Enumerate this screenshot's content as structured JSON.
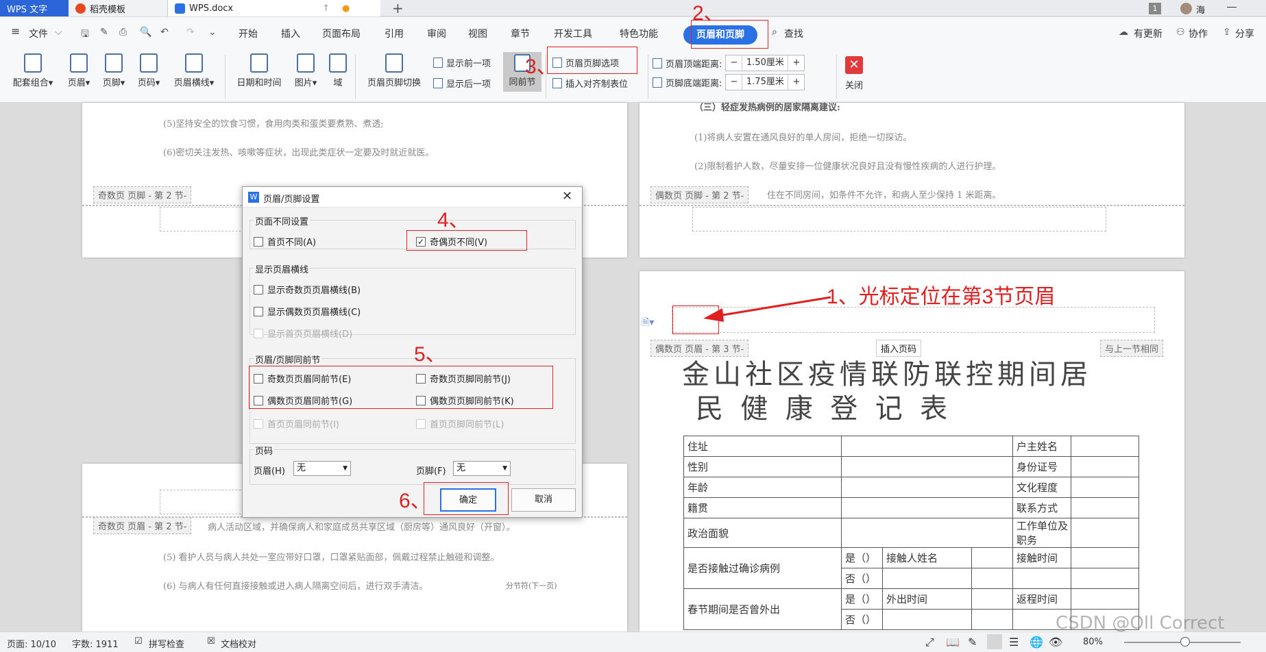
{
  "tabs": {
    "app": "WPS 文字",
    "docer": "稻壳模板",
    "doc": "WPS.docx",
    "user": "海",
    "badge": "1"
  },
  "menu": {
    "items": [
      "文件",
      "开始",
      "插入",
      "页面布局",
      "引用",
      "审阅",
      "视图",
      "章节",
      "开发工具",
      "特色功能",
      "页眉和页脚",
      "查找"
    ],
    "update": "有更新",
    "collab": "协作",
    "share": "分享"
  },
  "ribbon": {
    "combo": "配套组合",
    "header": "页眉",
    "footer": "页脚",
    "pagenum": "页码",
    "hline": "页眉横线",
    "datetime": "日期和时间",
    "picture": "图片",
    "field": "域",
    "switch": "页眉页脚切换",
    "prev": "显示前一项",
    "next": "显示后一项",
    "same": "同前节",
    "options": "页眉页脚选项",
    "align": "插入对齐制表位",
    "top_dist_label": "页眉顶端距离:",
    "top_dist": "1.50厘米",
    "bot_dist_label": "页脚底端距离:",
    "bot_dist": "1.75厘米",
    "close": "关闭"
  },
  "doc": {
    "p1l1": "(5)坚持安全的饮食习惯，食用肉类和蛋类要煮熟、煮透;",
    "p1l2": "(6)密切关注发热、咳嗽等症状，出现此类症状一定要及时就近就医。",
    "odd_footer": "奇数页 页脚 - 第 2 节-",
    "even_footer": "偶数页 页脚 - 第 2 节-",
    "p2l0": "（三）轻症发热病例的居家隔离建议:",
    "p2l1": "(1)将病人安置在通风良好的单人房间，拒绝一切探访。",
    "p2l2": "(2)限制看护人数，尽量安排一位健康状况良好且没有慢性疾病的人进行护理。",
    "p2l3": "住在不同房间，如条件不允许，和病人至少保持 1 米距离。",
    "even_header3": "偶数页 页眉 - 第 3 节-",
    "insert_pagenum": "插入页码",
    "same_as_prev": "与上一节相同",
    "title1": "金山社区疫情联防联控期间居",
    "title2": "民  健  康  登  记  表",
    "odd_header2": "奇数页 页眉 - 第 2 节-",
    "p3l1": "病人活动区域，并确保病人和家庭成员共享区域（厨房等）通风良好（开窗）。",
    "p3l2": "(5) 看护人员与病人共处一室应带好口罩，口罩紧贴面部，佩戴过程禁止触碰和调整。",
    "p3l3": "(6) 与病人有任何直接接触或进入病人隔离空间后，进行双手清洁。",
    "section_break": "分节符(下一页)"
  },
  "table": [
    [
      "住址",
      "",
      "户主姓名",
      ""
    ],
    [
      "性别",
      "",
      "身份证号",
      ""
    ],
    [
      "年龄",
      "",
      "文化程度",
      ""
    ],
    [
      "籍贯",
      "",
      "联系方式",
      ""
    ],
    [
      "政治面貌",
      "",
      "工作单位及职务",
      ""
    ]
  ],
  "table2": {
    "contact": "是否接触过确诊病例",
    "yes": "是（）",
    "no": "否（）",
    "contact_name": "接触人姓名",
    "contact_time": "接触时间",
    "travel": "春节期间是否曾外出",
    "out_time": "外出时间",
    "return_time": "返程时间"
  },
  "dialog": {
    "title": "页眉/页脚设置",
    "g1": "页面不同设置",
    "first_diff": "首页不同(A)",
    "odd_even_diff": "奇偶页不同(V)",
    "g2": "显示页眉横线",
    "show_odd": "显示奇数页页眉横线(B)",
    "show_even": "显示偶数页页眉横线(C)",
    "show_first": "显示首页页眉横线(D)",
    "g3": "页眉/页脚同前节",
    "odd_hdr_same": "奇数页页眉同前节(E)",
    "odd_ftr_same": "奇数页页脚同前节(J)",
    "even_hdr_same": "偶数页页眉同前节(G)",
    "even_ftr_same": "偶数页页脚同前节(K)",
    "first_hdr_same": "首页页眉同前节(I)",
    "first_ftr_same": "首页页脚同前节(L)",
    "g4": "页码",
    "header_sel_label": "页眉(H)",
    "header_sel": "无",
    "footer_sel_label": "页脚(F)",
    "footer_sel": "无",
    "ok": "确定",
    "cancel": "取消"
  },
  "annotations": {
    "n1": "1、光标定位在第3节页眉",
    "n2": "2、",
    "n3": "3、",
    "n4": "4、",
    "n5": "5、",
    "n6": "6、"
  },
  "status": {
    "page": "页面: 10/10",
    "words": "字数: 1911",
    "spell": "拼写检查",
    "proof": "文档校对",
    "zoom": "80%",
    "watermark": "CSDN @Oll Correct"
  },
  "colors": {
    "accent": "#2b71e6",
    "annotation": "#e02020"
  }
}
